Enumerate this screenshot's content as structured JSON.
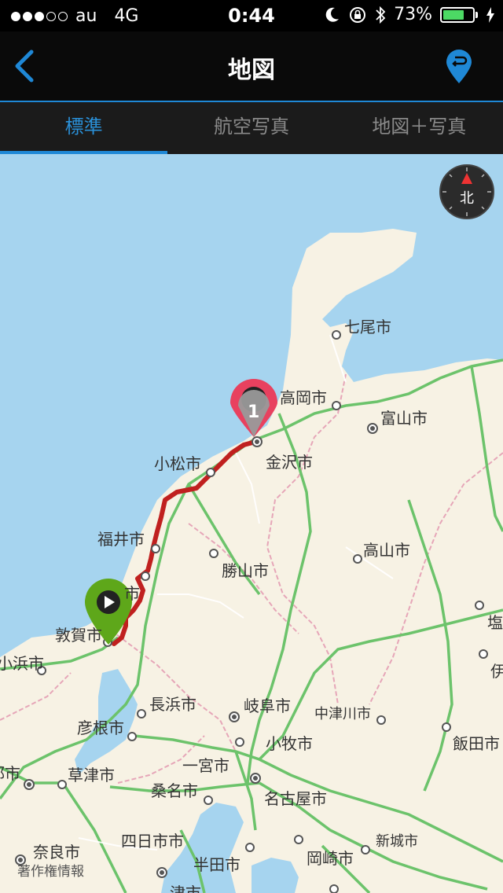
{
  "status_bar": {
    "carrier": "au",
    "network": "4G",
    "time": "0:44",
    "battery": "73%",
    "battery_level": 0.73
  },
  "nav": {
    "title": "地図"
  },
  "tabs": [
    {
      "label": "標準",
      "active": true
    },
    {
      "label": "航空写真",
      "active": false
    },
    {
      "label": "地図＋写真",
      "active": false
    }
  ],
  "map": {
    "compass_label": "北",
    "end_marker_label": "1",
    "copyright": "著作権情報",
    "cities": {
      "nanao": "七尾市",
      "takaoka": "高岡市",
      "toyama": "富山市",
      "komatsu": "小松市",
      "kanazawa": "金沢市",
      "fukui": "福井市",
      "takayama": "高山市",
      "katsuyama": "勝山市",
      "sabae": "市",
      "tsuruga": "敦賀市",
      "obama": "小浜市",
      "nagahama": "長浜市",
      "gifu": "岐阜市",
      "nakatsugawa": "中津川市",
      "hikone": "彦根市",
      "komaki": "小牧市",
      "iida": "飯田市",
      "kyoto_partial": "都市",
      "kusatsu": "草津市",
      "ichinomiya": "一宮市",
      "kuwana": "桑名市",
      "nagoya": "名古屋市",
      "yokkaichi": "四日市市",
      "shinshiro": "新城市",
      "nara": "奈良市",
      "handa": "半田市",
      "okazaki": "岡崎市",
      "tsu": "津市",
      "shio_partial": "塩",
      "i_partial": "伊"
    },
    "colors": {
      "sea": "#a6d4ef",
      "land": "#f7f2e4",
      "highway": "#6cc36b",
      "route": "#c0201f",
      "start": "#5ea71a",
      "end": "#e8415f"
    }
  }
}
